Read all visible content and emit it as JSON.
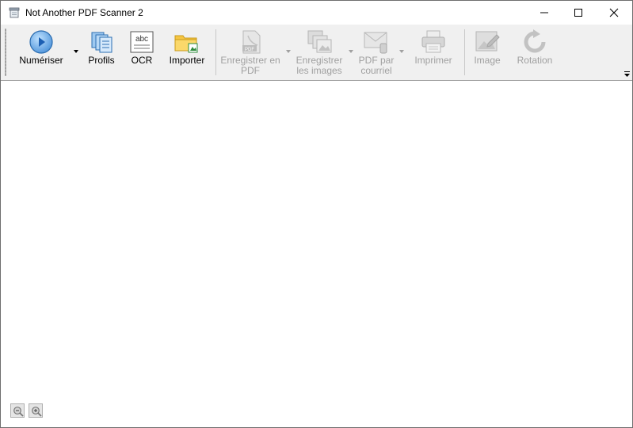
{
  "window": {
    "title": "Not Another PDF Scanner 2",
    "controls": [
      "minimize",
      "maximize",
      "close"
    ]
  },
  "toolbar": {
    "scan": {
      "label": "Numériser",
      "icon": "scan-icon",
      "enabled": true
    },
    "profiles": {
      "label": "Profils",
      "icon": "profiles-icon",
      "enabled": true
    },
    "ocr": {
      "label": "OCR",
      "icon": "ocr-icon",
      "icon_text": "abc",
      "enabled": true
    },
    "import": {
      "label": "Importer",
      "icon": "import-folder-icon",
      "enabled": true
    },
    "save_pdf": {
      "label_line1": "Enregistrer en",
      "label_line2": "PDF",
      "icon": "pdf-icon",
      "icon_text": "PDF",
      "enabled": false
    },
    "save_images": {
      "label_line1": "Enregistrer",
      "label_line2": "les images",
      "icon": "images-icon",
      "enabled": false
    },
    "email_pdf": {
      "label_line1": "PDF par",
      "label_line2": "courriel",
      "icon": "email-icon",
      "enabled": false
    },
    "print": {
      "label": "Imprimer",
      "icon": "printer-icon",
      "enabled": false
    },
    "image": {
      "label": "Image",
      "icon": "image-edit-icon",
      "enabled": false
    },
    "rotation": {
      "label": "Rotation",
      "icon": "rotate-icon",
      "enabled": false
    }
  },
  "zoom": {
    "zoom_out": "zoom-out-icon",
    "zoom_in": "zoom-in-icon"
  },
  "colors": {
    "toolbar_bg": "#f0f0f0",
    "disabled_text": "#a0a0a0",
    "scan_blue": "#2b78c8"
  }
}
